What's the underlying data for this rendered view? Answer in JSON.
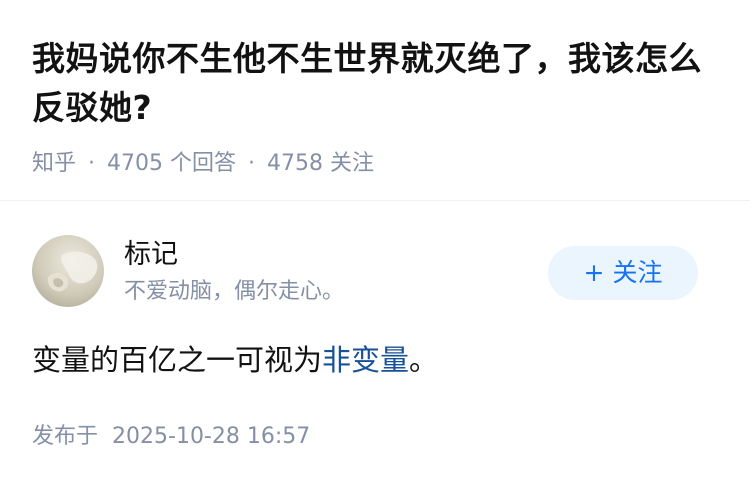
{
  "question": {
    "title": "我妈说你不生他不生世界就灭绝了，我该怎么反驳她?",
    "source": "知乎",
    "separator": "·",
    "answer_count": "4705",
    "answer_label": "个回答",
    "follower_count": "4758",
    "follower_label": "关注"
  },
  "author": {
    "avatar_icon": "avatar-image",
    "name": "标记",
    "bio": "不爱动脑，偶尔走心。",
    "follow_plus": "+",
    "follow_label": "关注"
  },
  "answer": {
    "text_before_link": "变量的百亿之一可视为",
    "link_text": "非变量",
    "text_after_link": "。"
  },
  "publish": {
    "label": "发布于",
    "datetime": "2025-10-28 16:57"
  },
  "colors": {
    "meta_gray": "#8590a6",
    "follow_blue": "#1772f6",
    "follow_bg": "#ebf5fd",
    "link_blue": "#175199",
    "divider": "#f0f2f7"
  }
}
